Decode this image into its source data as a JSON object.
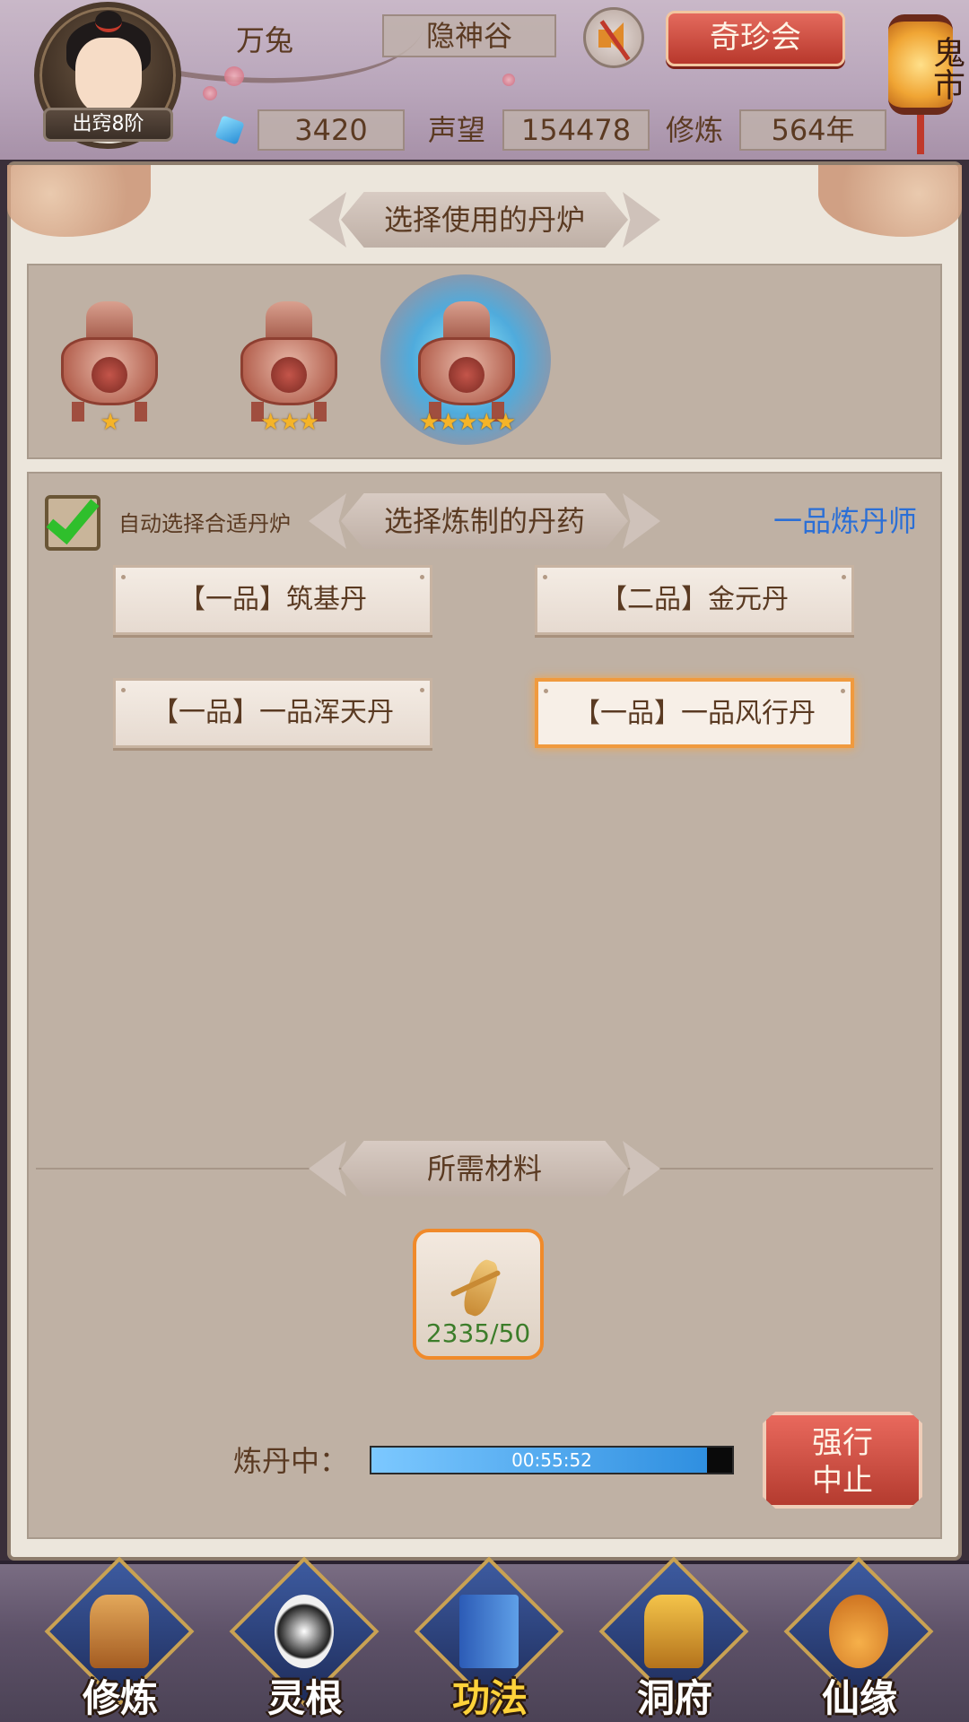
{
  "header": {
    "player_name": "万兔",
    "rank": "出窍8阶",
    "location": "隐神谷",
    "treasure_button": "奇珍会",
    "lantern_text": "鬼市",
    "gems": "3420",
    "reputation_label": "声望",
    "reputation": "154478",
    "cultivation_label": "修炼",
    "cultivation": "564年"
  },
  "furnace_section": {
    "title": "选择使用的丹炉",
    "furnaces": [
      {
        "stars": "★",
        "star_count": 1,
        "selected": false
      },
      {
        "stars": "★★★",
        "star_count": 3,
        "selected": false
      },
      {
        "stars": "★★★★★",
        "star_count": 5,
        "selected": true
      }
    ]
  },
  "recipe_section": {
    "title": "选择炼制的丹药",
    "auto_select_label": "自动选择合适丹炉",
    "auto_select_checked": true,
    "alchemist_rank": "一品炼丹师",
    "recipes": [
      {
        "label": "【一品】筑基丹",
        "selected": false
      },
      {
        "label": "【二品】金元丹",
        "selected": false
      },
      {
        "label": "【一品】一品浑天丹",
        "selected": false
      },
      {
        "label": "【一品】一品风行丹",
        "selected": true
      }
    ]
  },
  "materials_section": {
    "title": "所需材料",
    "material_icon": "ginseng-icon",
    "material_count": "2335/50"
  },
  "refining": {
    "label": "炼丹中：",
    "time_remaining": "00:55:52",
    "progress_fraction": 0.93,
    "stop_button_line1": "强行",
    "stop_button_line2": "中止"
  },
  "bottom_nav": [
    {
      "label": "修炼",
      "icon": "cultivate-icon",
      "active": false
    },
    {
      "label": "灵根",
      "icon": "spirit-root-icon",
      "active": false
    },
    {
      "label": "功法",
      "icon": "technique-book-icon",
      "active": true
    },
    {
      "label": "洞府",
      "icon": "cave-dwelling-icon",
      "active": false
    },
    {
      "label": "仙缘",
      "icon": "gourd-icon",
      "active": false
    }
  ],
  "colors": {
    "accent_red": "#c0392b",
    "rank_blue": "#2b6fd6",
    "selected_orange": "#f09a3e",
    "count_green": "#3c7d2a",
    "active_nav_yellow": "#ffd23a"
  }
}
